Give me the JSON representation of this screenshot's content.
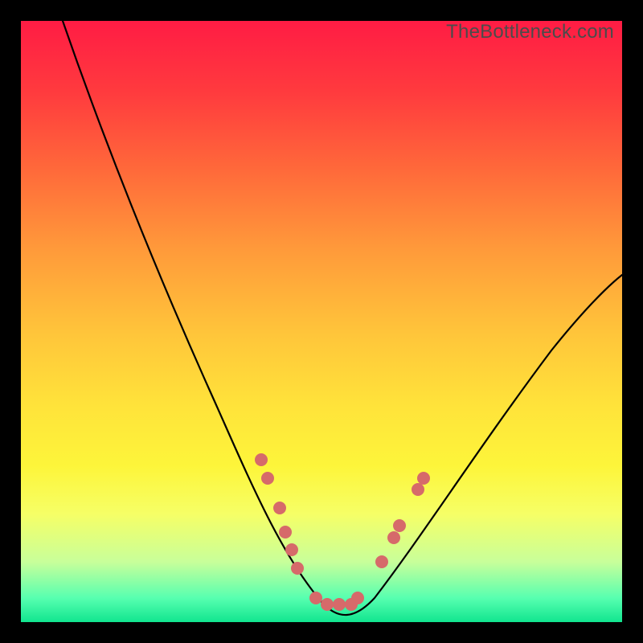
{
  "watermark": "TheBottleneck.com",
  "colors": {
    "frame_border": "#000000",
    "gradient_top": "#ff1c44",
    "gradient_bottom": "#11e58f",
    "curve": "#000000",
    "markers": "#d66a6a"
  },
  "chart_data": {
    "type": "line",
    "title": "",
    "xlabel": "",
    "ylabel": "",
    "xlim": [
      0,
      100
    ],
    "ylim": [
      0,
      100
    ],
    "grid": false,
    "series": [
      {
        "name": "bottleneck-curve",
        "x": [
          7,
          15,
          22,
          30,
          37,
          43,
          47,
          50,
          53,
          57,
          62,
          70,
          80,
          90,
          100
        ],
        "y": [
          100,
          82,
          66,
          50,
          35,
          22,
          12,
          5,
          3,
          5,
          12,
          25,
          40,
          50,
          58
        ]
      }
    ],
    "markers": [
      {
        "x": 40,
        "y": 27
      },
      {
        "x": 41,
        "y": 24
      },
      {
        "x": 43,
        "y": 19
      },
      {
        "x": 44,
        "y": 15
      },
      {
        "x": 45,
        "y": 12
      },
      {
        "x": 46,
        "y": 9
      },
      {
        "x": 49,
        "y": 4
      },
      {
        "x": 51,
        "y": 3
      },
      {
        "x": 53,
        "y": 3
      },
      {
        "x": 55,
        "y": 3
      },
      {
        "x": 56,
        "y": 4
      },
      {
        "x": 60,
        "y": 10
      },
      {
        "x": 62,
        "y": 14
      },
      {
        "x": 63,
        "y": 16
      },
      {
        "x": 66,
        "y": 22
      },
      {
        "x": 67,
        "y": 24
      }
    ]
  }
}
